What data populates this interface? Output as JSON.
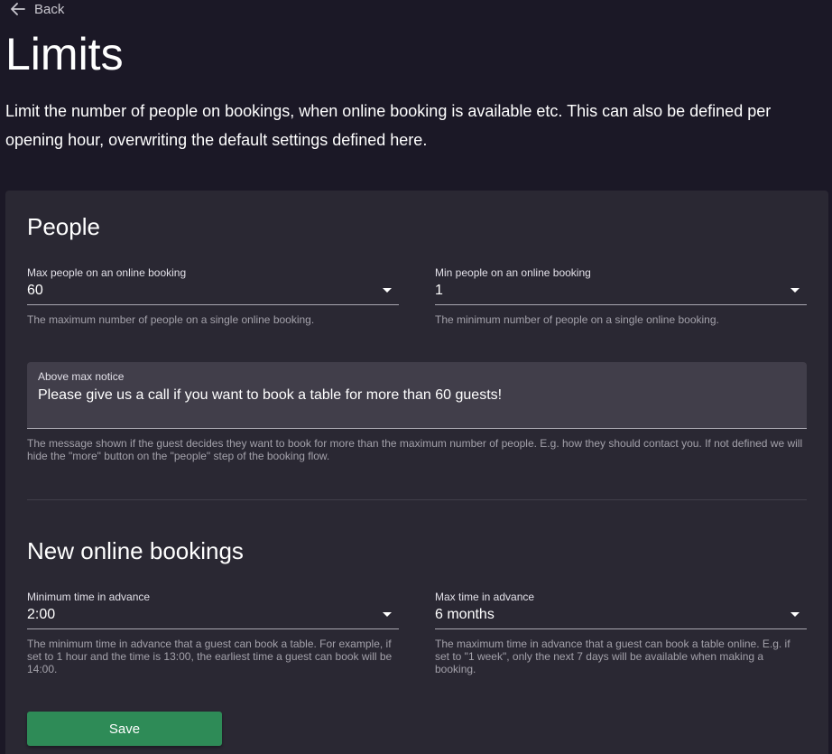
{
  "nav": {
    "back_label": "Back"
  },
  "header": {
    "title": "Limits",
    "description": "Limit the number of people on bookings, when online booking is available etc. This can also be defined per opening hour, overwriting the default settings defined here."
  },
  "people": {
    "title": "People",
    "max_people": {
      "label": "Max people on an online booking",
      "value": "60",
      "hint": "The maximum number of people on a single online booking."
    },
    "min_people": {
      "label": "Min people on an online booking",
      "value": "1",
      "hint": "The minimum number of people on a single online booking."
    },
    "above_max_notice": {
      "label": "Above max notice",
      "value": "Please give us a call if you want to book a table for more than 60 guests!",
      "hint": "The message shown if the guest decides they want to book for more than the maximum number of people. E.g. how they should contact you. If not defined we will hide the \"more\" button on the \"people\" step of the booking flow."
    }
  },
  "new_online_bookings": {
    "title": "New online bookings",
    "min_time": {
      "label": "Minimum time in advance",
      "value": "2:00",
      "hint": "The minimum time in advance that a guest can book a table. For example, if set to 1 hour and the time is 13:00, the earliest time a guest can book will be 14:00."
    },
    "max_time": {
      "label": "Max time in advance",
      "value": "6 months",
      "hint": "The maximum time in advance that a guest can book a table online. E.g. if set to \"1 week\", only the next 7 days will be available when making a booking."
    }
  },
  "actions": {
    "save_label": "Save"
  },
  "colors": {
    "page_background": "#1b1826",
    "card_background": "#2a2833",
    "field_background": "#413e4a",
    "save_button": "#2e8b57"
  },
  "icons": {
    "back": "arrow-left-icon",
    "dropdown": "caret-down-icon"
  }
}
